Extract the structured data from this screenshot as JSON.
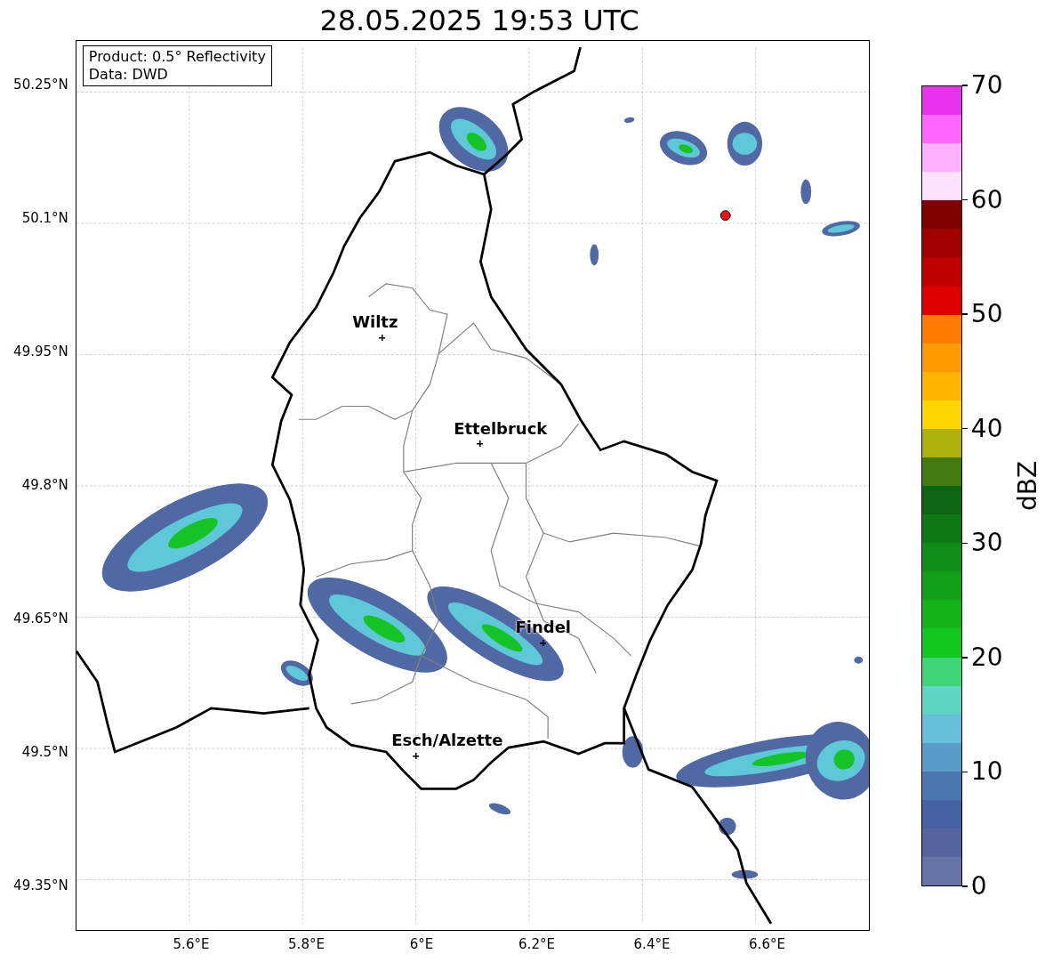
{
  "title": "28.05.2025 19:53 UTC",
  "info_box": [
    "Product: 0.5° Reflectivity",
    "Data: DWD"
  ],
  "lat_labels": [
    "50.25°N",
    "50.1°N",
    "49.95°N",
    "49.8°N",
    "49.65°N",
    "49.5°N",
    "49.35°N"
  ],
  "lon_labels": [
    "5.6°E",
    "5.8°E",
    "6°E",
    "6.2°E",
    "6.4°E",
    "6.6°E"
  ],
  "cities": [
    {
      "name": "Wiltz"
    },
    {
      "name": "Ettelbruck"
    },
    {
      "name": "Findel"
    },
    {
      "name": "Esch/Alzette"
    }
  ],
  "colorbar": {
    "label": "dBZ",
    "ticks": [
      "70",
      "60",
      "50",
      "40",
      "30",
      "20",
      "10",
      "0"
    ],
    "bins": [
      {
        "color": "#e833ee"
      },
      {
        "color": "#ff66ff"
      },
      {
        "color": "#ffb0ff"
      },
      {
        "color": "#ffe0ff"
      },
      {
        "color": "#800000"
      },
      {
        "color": "#a00000"
      },
      {
        "color": "#c00000"
      },
      {
        "color": "#e00000"
      },
      {
        "color": "#ff7c00"
      },
      {
        "color": "#ff9a00"
      },
      {
        "color": "#ffb400"
      },
      {
        "color": "#ffd700"
      },
      {
        "color": "#b0b00a"
      },
      {
        "color": "#447a10"
      },
      {
        "color": "#0a6612"
      },
      {
        "color": "#0e7a16"
      },
      {
        "color": "#108c18"
      },
      {
        "color": "#12a018"
      },
      {
        "color": "#12b418"
      },
      {
        "color": "#12c820"
      },
      {
        "color": "#3ed678"
      },
      {
        "color": "#5ed6c6"
      },
      {
        "color": "#66c0dc"
      },
      {
        "color": "#5a9cc8"
      },
      {
        "color": "#4a78b0"
      },
      {
        "color": "#4560a3"
      },
      {
        "color": "#53649e"
      },
      {
        "color": "#6474a6"
      }
    ]
  }
}
